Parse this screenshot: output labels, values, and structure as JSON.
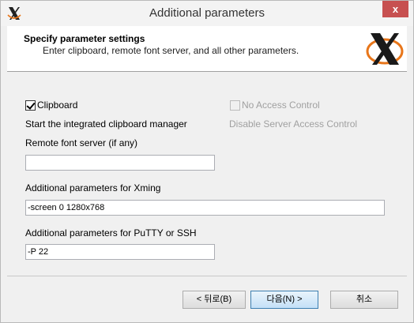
{
  "window": {
    "title": "Additional parameters",
    "close_glyph": "x"
  },
  "header": {
    "title": "Specify parameter settings",
    "subtitle": "Enter clipboard, remote font server, and all other parameters."
  },
  "clipboard": {
    "label": "Clipboard",
    "checked": true,
    "description": "Start the integrated clipboard manager"
  },
  "access_control": {
    "label": "No Access Control",
    "checked": false,
    "enabled": false,
    "description": "Disable Server Access Control"
  },
  "font_server": {
    "label": "Remote font server (if any)",
    "value": ""
  },
  "xming_params": {
    "label": "Additional parameters for Xming",
    "value": "-screen 0 1280x768"
  },
  "putty_params": {
    "label": "Additional parameters for PuTTY or SSH",
    "value": "-P 22"
  },
  "buttons": {
    "back": "< 뒤로(B)",
    "next": "다음(N) >",
    "cancel": "취소"
  },
  "colors": {
    "accent_orange": "#e8761a",
    "close_red": "#c75050"
  }
}
